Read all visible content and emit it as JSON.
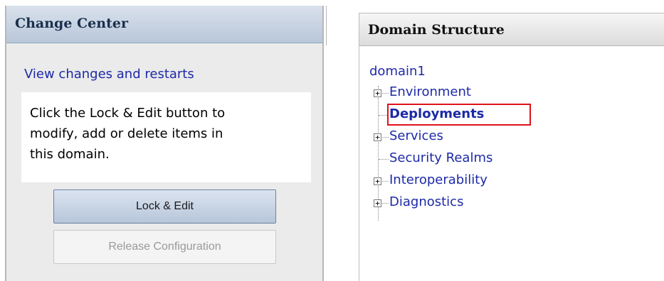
{
  "change_center": {
    "title": "Change Center",
    "view_changes_link": "View changes and restarts",
    "description": [
      "Click the Lock & Edit button to",
      "modify, add or delete items in",
      "this domain."
    ],
    "lock_edit_button": "Lock & Edit",
    "release_button": "Release Configuration"
  },
  "domain_structure": {
    "title": "Domain Structure",
    "root": "domain1",
    "items": [
      {
        "label": "Environment",
        "expander": "+",
        "selected": false
      },
      {
        "label": "Deployments",
        "expander": "",
        "selected": true
      },
      {
        "label": "Services",
        "expander": "+",
        "selected": false
      },
      {
        "label": "Security Realms",
        "expander": "",
        "selected": false
      },
      {
        "label": "Interoperability",
        "expander": "+",
        "selected": false
      },
      {
        "label": "Diagnostics",
        "expander": "+",
        "selected": false
      }
    ]
  },
  "colors": {
    "link": "#1d2aa6",
    "highlight": "#e0121a",
    "header_blue": "#b9c7da"
  }
}
